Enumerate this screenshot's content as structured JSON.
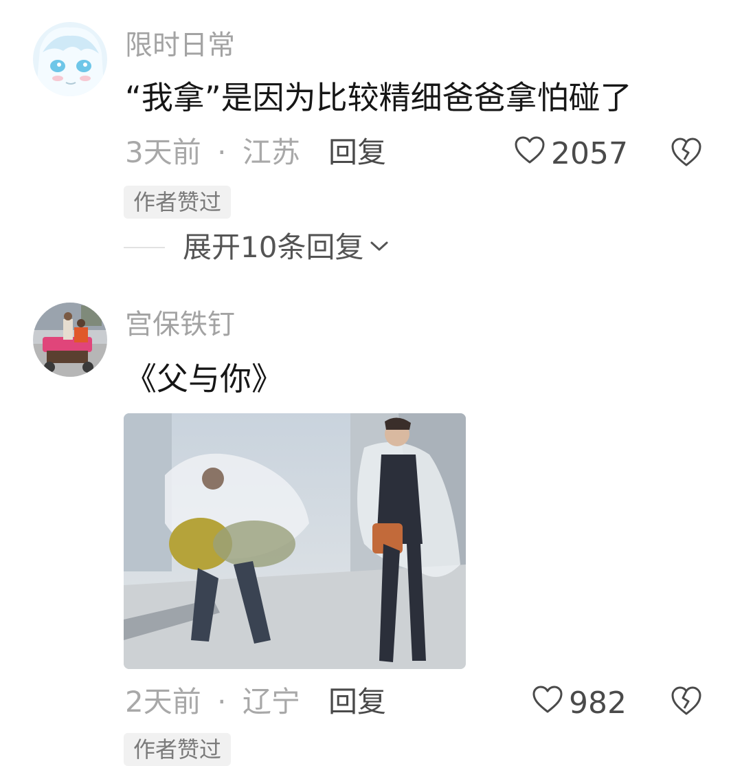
{
  "comments": [
    {
      "username": "限时日常",
      "text": "“我拿”是因为比较精细爸爸拿怕碰了",
      "time": "3天前",
      "separator": "·",
      "location": "江苏",
      "reply_label": "回复",
      "likes": "2057",
      "badge": "作者赞过",
      "expand_label": "展开10条回复"
    },
    {
      "username": "宫保铁钉",
      "text": "《父与你》",
      "time": "2天前",
      "separator": "·",
      "location": "辽宁",
      "reply_label": "回复",
      "likes": "982",
      "badge": "作者赞过"
    }
  ],
  "icons": {
    "like": "heart-outline-icon",
    "dislike": "broken-heart-icon",
    "expand": "chevron-down-icon"
  },
  "colors": {
    "username": "#a3a3a3",
    "text": "#161616",
    "meta": "#a8a8a8",
    "badge_bg": "#f1f1f1"
  }
}
